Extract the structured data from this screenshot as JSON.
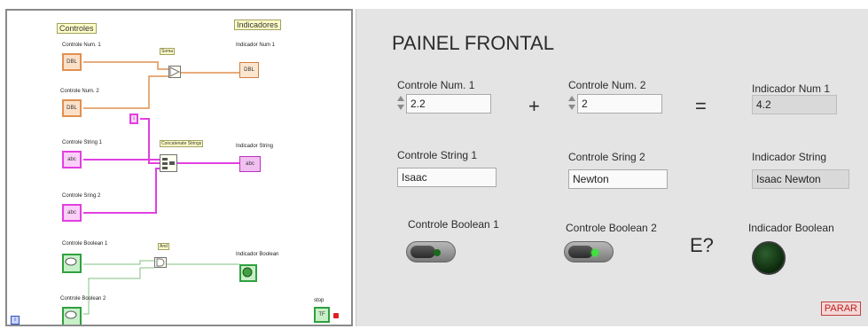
{
  "block_diagram": {
    "controls_header": "Controles",
    "indicators_header": "Indicadores",
    "terminals": {
      "num1_label": "Controle Num. 1",
      "num1_text": "DBL",
      "num2_label": "Controle Num. 2",
      "num2_text": "DBL",
      "string1_label": "Controle String 1",
      "string1_text": "abc",
      "string2_label": "Controle Sring 2",
      "string2_text": "abc",
      "bool1_label": "Controle Boolean 1",
      "bool2_label": "Controle Boolean 2",
      "ind_num_label": "Indicador Num 1",
      "ind_num_text": "DBL",
      "ind_string_label": "Indicador String",
      "ind_string_text": "abc",
      "ind_bool_label": "Indicador Boolean",
      "stop_label": "stop",
      "stop_text": "TF"
    },
    "nodes": {
      "add_label": "Soma",
      "concat_label": "Concatenate Strings",
      "and_label": "And",
      "constant_text": "i",
      "loop_iteration": "i"
    }
  },
  "front_panel": {
    "title": "PAINEL FRONTAL",
    "num1": {
      "label": "Controle Num. 1",
      "value": "2.2"
    },
    "plus": "+",
    "num2": {
      "label": "Controle Num. 2",
      "value": "2"
    },
    "equals": "=",
    "ind_num": {
      "label": "Indicador Num 1",
      "value": "4.2"
    },
    "str1": {
      "label": "Controle String 1",
      "value": "Isaac"
    },
    "str2": {
      "label": "Controle Sring 2",
      "value": "Newton"
    },
    "ind_str": {
      "label": "Indicador String",
      "value": "Isaac Newton"
    },
    "bool1": {
      "label": "Controle Boolean 1",
      "state": "off"
    },
    "bool2": {
      "label": "Controle Boolean 2",
      "state": "on"
    },
    "and_question": "E?",
    "ind_bool": {
      "label": "Indicador Boolean",
      "state": "off"
    },
    "stop_button": "PARAR"
  },
  "colors": {
    "numeric": "#e09050",
    "string": "#e040e0",
    "boolean": "#30a040",
    "led_off": "#0b2a0b",
    "led_on": "#40e040"
  }
}
